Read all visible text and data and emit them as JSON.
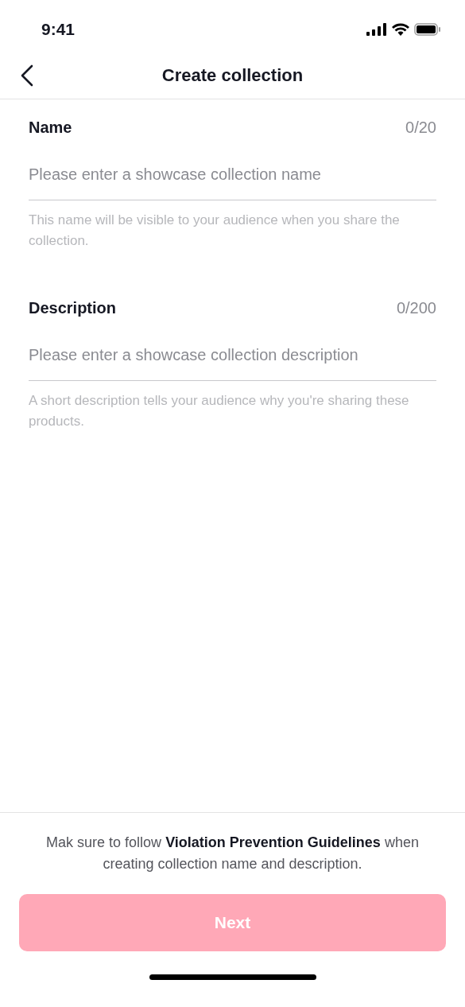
{
  "status_bar": {
    "time": "9:41"
  },
  "header": {
    "title": "Create collection"
  },
  "fields": [
    {
      "label": "Name",
      "counter": "0/20",
      "placeholder": "Please enter a showcase collection name",
      "hint": "This name will be visible to your audience when you share the collection."
    },
    {
      "label": "Description",
      "counter": "0/200",
      "placeholder": "Please enter a showcase collection description",
      "hint": "A short description tells your audience why you're sharing these products."
    }
  ],
  "footer": {
    "notice_before": "Mak sure to follow",
    "notice_link": "Violation Prevention Guidelines",
    "notice_after": "when creating collection name and description.",
    "button": {
      "label": "Next",
      "disabled": true
    }
  }
}
